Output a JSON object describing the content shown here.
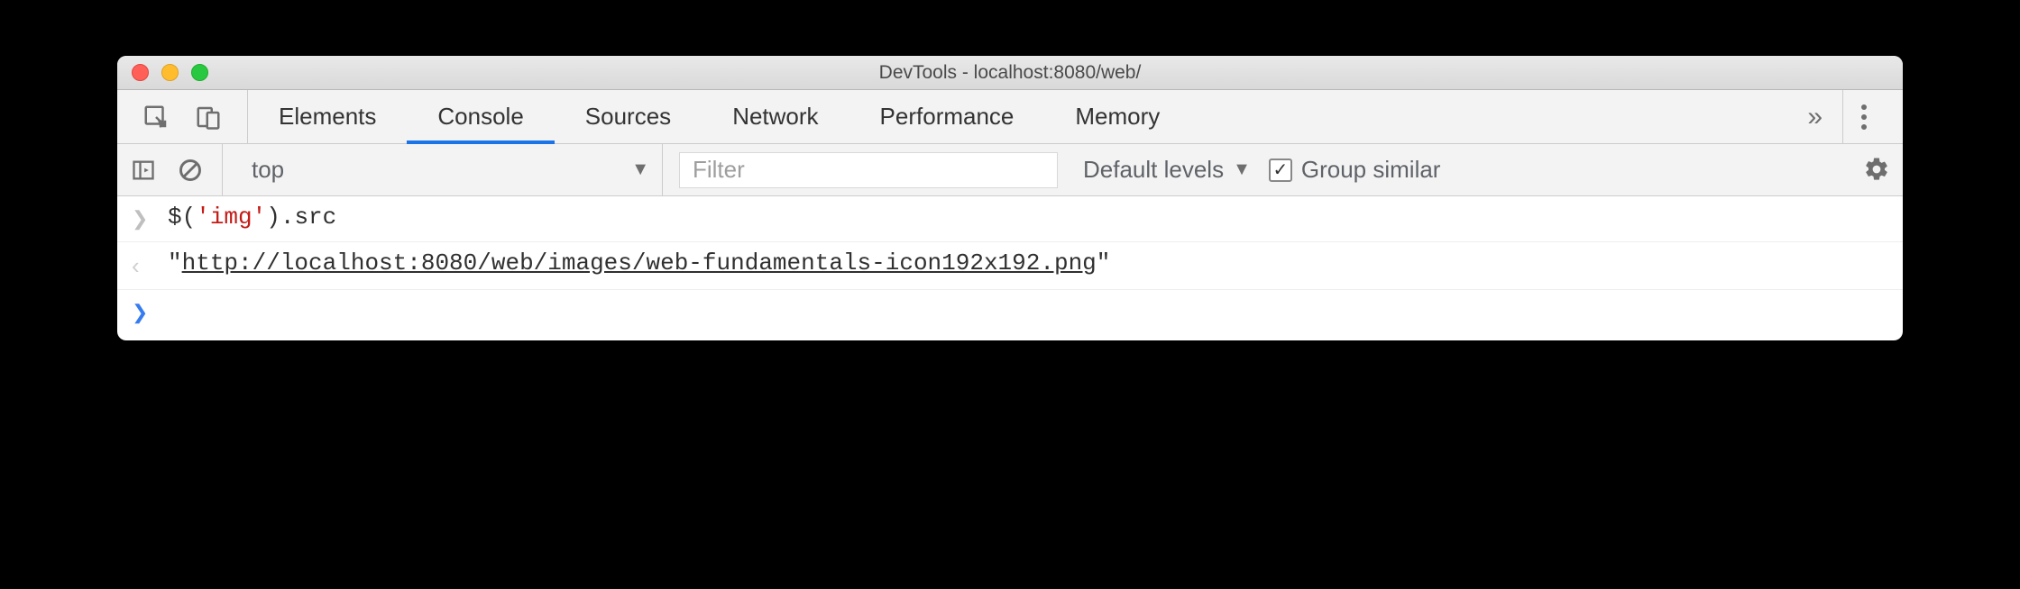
{
  "window": {
    "title": "DevTools - localhost:8080/web/"
  },
  "tabs": {
    "items": [
      "Elements",
      "Console",
      "Sources",
      "Network",
      "Performance",
      "Memory"
    ],
    "active_index": 1,
    "overflow_glyph": "»"
  },
  "console_toolbar": {
    "context": "top",
    "filter_placeholder": "Filter",
    "levels_label": "Default levels",
    "group_similar_label": "Group similar",
    "group_similar_checked": true
  },
  "console": {
    "entries": [
      {
        "kind": "input",
        "code_segments": [
          {
            "t": "$",
            "c": "tok-fn"
          },
          {
            "t": "(",
            "c": "tok-paren"
          },
          {
            "t": "'img'",
            "c": "tok-str"
          },
          {
            "t": ")",
            "c": "tok-paren"
          },
          {
            "t": ".src",
            "c": "tok-prop"
          }
        ]
      },
      {
        "kind": "output",
        "string_prefix": "\"",
        "string_url": "http://localhost:8080/web/images/web-fundamentals-icon192x192.png",
        "string_suffix": "\""
      },
      {
        "kind": "prompt"
      }
    ]
  }
}
